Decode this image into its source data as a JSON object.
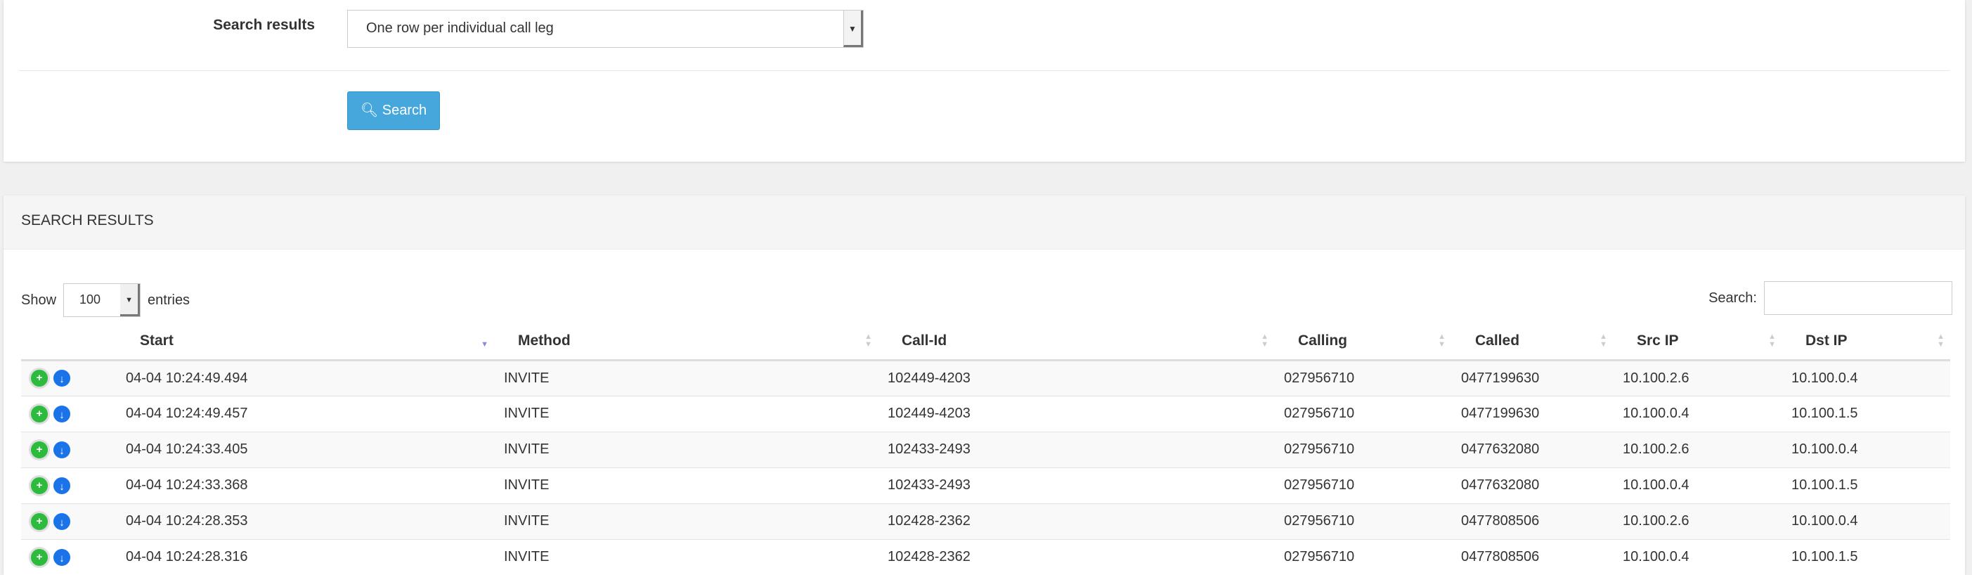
{
  "form": {
    "search_results_label": "Search results",
    "search_results_value": "One row per individual call leg",
    "search_button": "Search"
  },
  "results": {
    "title": "SEARCH RESULTS",
    "show_label": "Show",
    "entries_value": "100",
    "entries_label": "entries",
    "search_label": "Search:",
    "search_value": "",
    "columns": [
      "Start",
      "Method",
      "Call-Id",
      "Calling",
      "Called",
      "Src IP",
      "Dst IP"
    ],
    "sorted_column": "Start",
    "rows": [
      [
        "04-04 10:24:49.494",
        "INVITE",
        "102449-4203",
        "027956710",
        "0477199630",
        "10.100.2.6",
        "10.100.0.4"
      ],
      [
        "04-04 10:24:49.457",
        "INVITE",
        "102449-4203",
        "027956710",
        "0477199630",
        "10.100.0.4",
        "10.100.1.5"
      ],
      [
        "04-04 10:24:33.405",
        "INVITE",
        "102433-2493",
        "027956710",
        "0477632080",
        "10.100.2.6",
        "10.100.0.4"
      ],
      [
        "04-04 10:24:33.368",
        "INVITE",
        "102433-2493",
        "027956710",
        "0477632080",
        "10.100.0.4",
        "10.100.1.5"
      ],
      [
        "04-04 10:24:28.353",
        "INVITE",
        "102428-2362",
        "027956710",
        "0477808506",
        "10.100.2.6",
        "10.100.0.4"
      ],
      [
        "04-04 10:24:28.316",
        "INVITE",
        "102428-2362",
        "027956710",
        "0477808506",
        "10.100.0.4",
        "10.100.1.5"
      ]
    ]
  },
  "colors": {
    "accent": "#46a7dc",
    "add_icon": "#2cbb3c",
    "download_icon": "#1a73e8"
  }
}
